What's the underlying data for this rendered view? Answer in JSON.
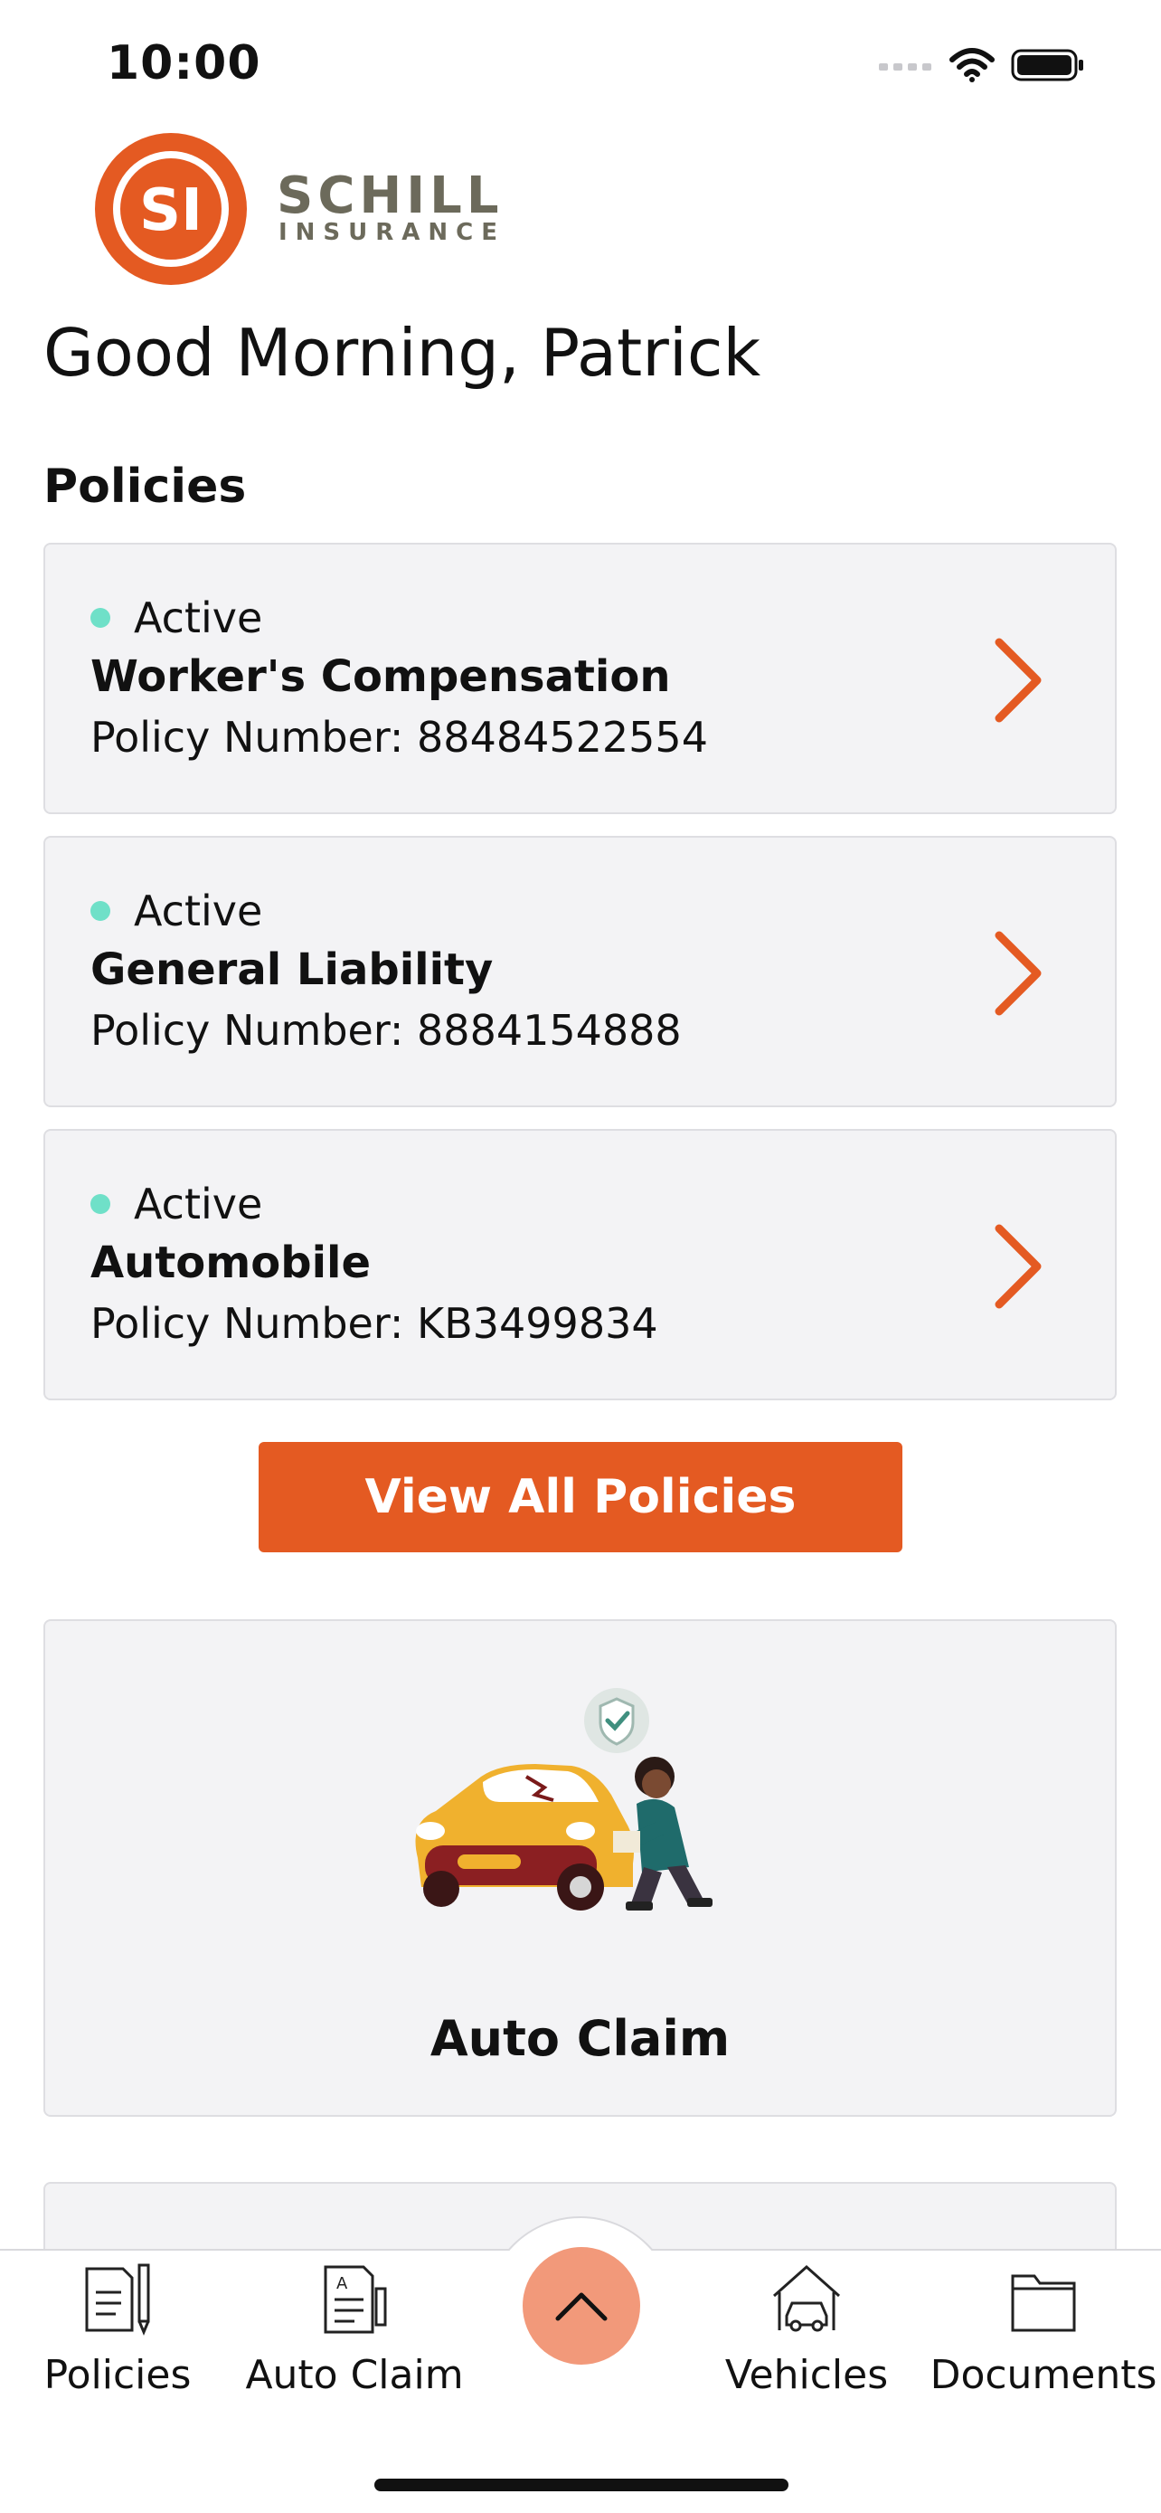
{
  "status_bar": {
    "time": "10:00",
    "icons": [
      "signal-icon",
      "wifi-icon",
      "battery-icon"
    ]
  },
  "brand": {
    "logo_mark": "SI",
    "logo_name": "SCHILL",
    "logo_sub": "INSURANCE",
    "accent_color": "#e45a22",
    "active_color": "#6fe0c8"
  },
  "greeting": "Good Morning, Patrick",
  "policies": {
    "title": "Policies",
    "items": [
      {
        "status": "Active",
        "name": "Worker's Compensation",
        "number": "Policy Number: 88484522554"
      },
      {
        "status": "Active",
        "name": "General Liability",
        "number": "Policy Number: 8884154888"
      },
      {
        "status": "Active",
        "name": "Automobile",
        "number": "Policy Number: KB3499834"
      }
    ],
    "view_all_label": "View All Policies"
  },
  "claim_card": {
    "label": "Auto Claim",
    "illustration": "auto-claim-illustration"
  },
  "tab_bar": {
    "items": [
      {
        "label": "Policies",
        "icon": "policies-icon"
      },
      {
        "label": "Auto Claim",
        "icon": "auto-claim-icon"
      },
      {
        "label": "Vehicles",
        "icon": "vehicles-icon"
      },
      {
        "label": "Documents",
        "icon": "documents-icon"
      }
    ],
    "fab_icon": "chevron-up-icon"
  }
}
